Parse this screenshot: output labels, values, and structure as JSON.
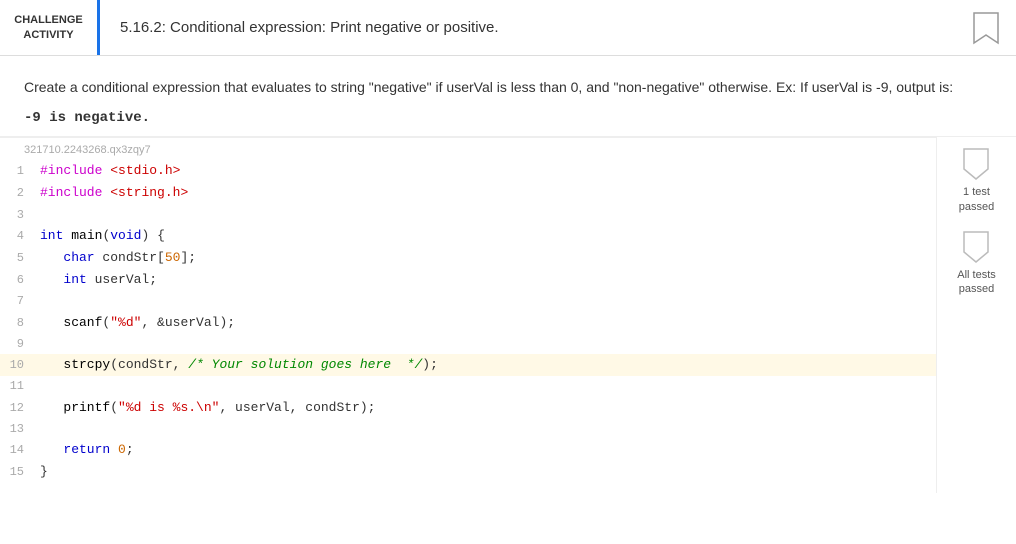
{
  "header": {
    "badge_line1": "CHALLENGE",
    "badge_line2": "ACTIVITY",
    "title": "5.16.2: Conditional expression: Print negative or positive.",
    "bookmark_icon": "bookmark"
  },
  "description": {
    "text": "Create a conditional expression that evaluates to string \"negative\" if userVal is less than 0, and \"non-negative\" otherwise. Ex: If userVal is -9, output is:",
    "example": "-9 is negative."
  },
  "code": {
    "id": "321710.2243268.qx3zqy7",
    "lines": [
      {
        "num": "1",
        "content": "#include <stdio.h>",
        "highlight": false
      },
      {
        "num": "2",
        "content": "#include <string.h>",
        "highlight": false
      },
      {
        "num": "3",
        "content": "",
        "highlight": false
      },
      {
        "num": "4",
        "content": "int main(void) {",
        "highlight": false
      },
      {
        "num": "5",
        "content": "   char condStr[50];",
        "highlight": false
      },
      {
        "num": "6",
        "content": "   int userVal;",
        "highlight": false
      },
      {
        "num": "7",
        "content": "",
        "highlight": false
      },
      {
        "num": "8",
        "content": "   scanf(\"%d\", &userVal);",
        "highlight": false
      },
      {
        "num": "9",
        "content": "",
        "highlight": false
      },
      {
        "num": "10",
        "content": "   strcpy(condStr, /* Your solution goes here  */);",
        "highlight": true
      },
      {
        "num": "11",
        "content": "",
        "highlight": false
      },
      {
        "num": "12",
        "content": "   printf(\"%d is %s.\\n\", userVal, condStr);",
        "highlight": false
      },
      {
        "num": "13",
        "content": "",
        "highlight": false
      },
      {
        "num": "14",
        "content": "   return 0;",
        "highlight": false
      },
      {
        "num": "15",
        "content": "}",
        "highlight": false
      }
    ]
  },
  "sidebar": {
    "test1_label": "1 test\npassed",
    "test2_label": "All tests\npassed"
  }
}
